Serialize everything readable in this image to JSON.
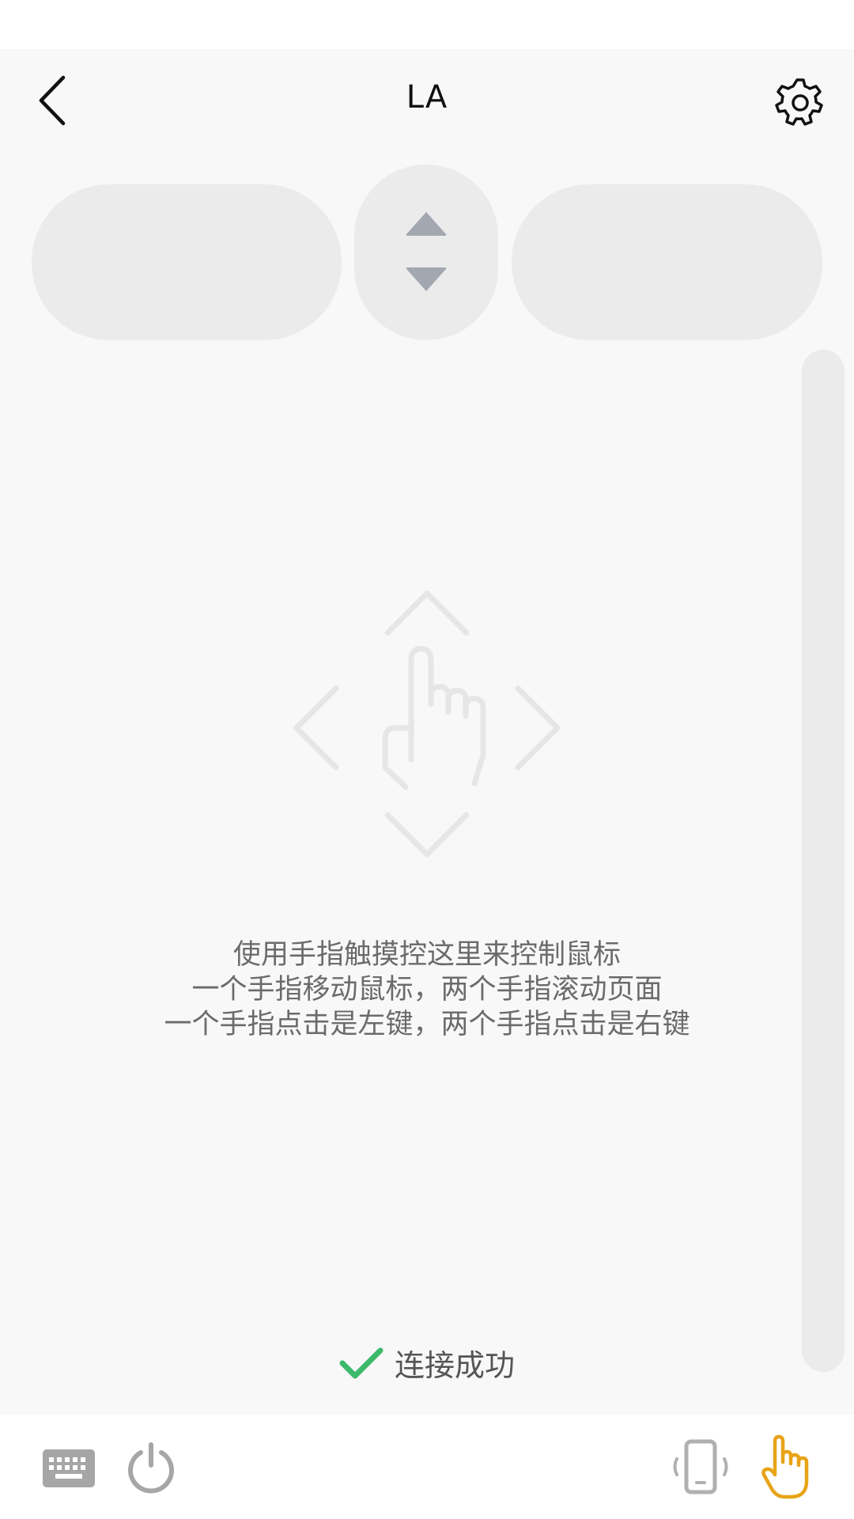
{
  "header": {
    "title": "LA"
  },
  "touchpad": {
    "hint_lines": [
      "使用手指触摸控这里来控制鼠标",
      "一个手指移动鼠标，两个手指滚动页面",
      "一个手指点击是左键，两个手指点击是右键"
    ]
  },
  "status": {
    "connection_label": "连接成功",
    "color": "#3cb96b"
  },
  "colors": {
    "accent": "#e8a317",
    "button_bg": "#ebebeb",
    "arrow": "#a3a7b0",
    "icon_gray": "#a6a6a6"
  },
  "icons": {
    "back": "chevron-left-icon",
    "settings": "gear-icon",
    "scroll_up": "triangle-up-icon",
    "scroll_down": "triangle-down-icon",
    "gesture": "hand-pointer-icon",
    "check": "check-icon",
    "keyboard": "keyboard-icon",
    "power": "power-icon",
    "phone_vibrate": "phone-vibrate-icon",
    "touch": "hand-touch-icon"
  }
}
